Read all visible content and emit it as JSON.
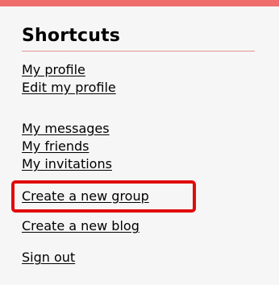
{
  "shortcuts": {
    "title": "Shortcuts",
    "links": {
      "my_profile": "My profile",
      "edit_my_profile": "Edit my profile",
      "my_messages": "My messages",
      "my_friends": "My friends",
      "my_invitations": "My invitations",
      "create_group": "Create a new group",
      "create_blog": "Create a new blog",
      "sign_out": "Sign out"
    }
  },
  "colors": {
    "top_bar": "#ef6d6d",
    "highlight_border": "#e00b0b",
    "panel_background": "#f6f6f6",
    "rule": "#e79494"
  }
}
